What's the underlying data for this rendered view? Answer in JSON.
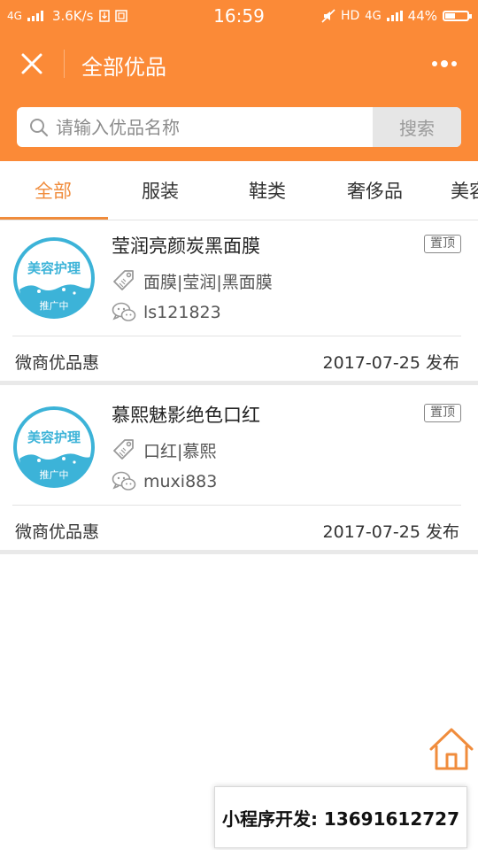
{
  "status_bar": {
    "network": "4G",
    "speed": "3.6K/s",
    "time": "16:59",
    "hd": "HD",
    "network_right": "4G",
    "battery": "44%",
    "battery_level": 0.44
  },
  "header": {
    "title": "全部优品",
    "close_icon": "close-icon",
    "more_icon": "more-dots-icon",
    "bg_color": "#fb8a37"
  },
  "search": {
    "placeholder": "请输入优品名称",
    "button_label": "搜索"
  },
  "tabs": [
    {
      "label": "全部",
      "active": true
    },
    {
      "label": "服装",
      "active": false
    },
    {
      "label": "鞋类",
      "active": false
    },
    {
      "label": "奢侈品",
      "active": false
    },
    {
      "label": "美容",
      "active": false
    }
  ],
  "accent_color": "#f08c3c",
  "items": [
    {
      "logo_text": "美容护理",
      "logo_sub": "推广中",
      "title": "莹润亮颜炭黑面膜",
      "badge": "置顶",
      "tags": "面膜|莹润|黑面膜",
      "wechat": "ls121823",
      "source": "微商优品惠",
      "date": "2017-07-25  发布"
    },
    {
      "logo_text": "美容护理",
      "logo_sub": "推广中",
      "title": "慕熙魅影绝色口红",
      "badge": "置顶",
      "tags": "口红|慕熙",
      "wechat": "muxi883",
      "source": "微商优品惠",
      "date": "2017-07-25  发布"
    }
  ],
  "banner": {
    "text": "小程序开发:  13691612727"
  }
}
